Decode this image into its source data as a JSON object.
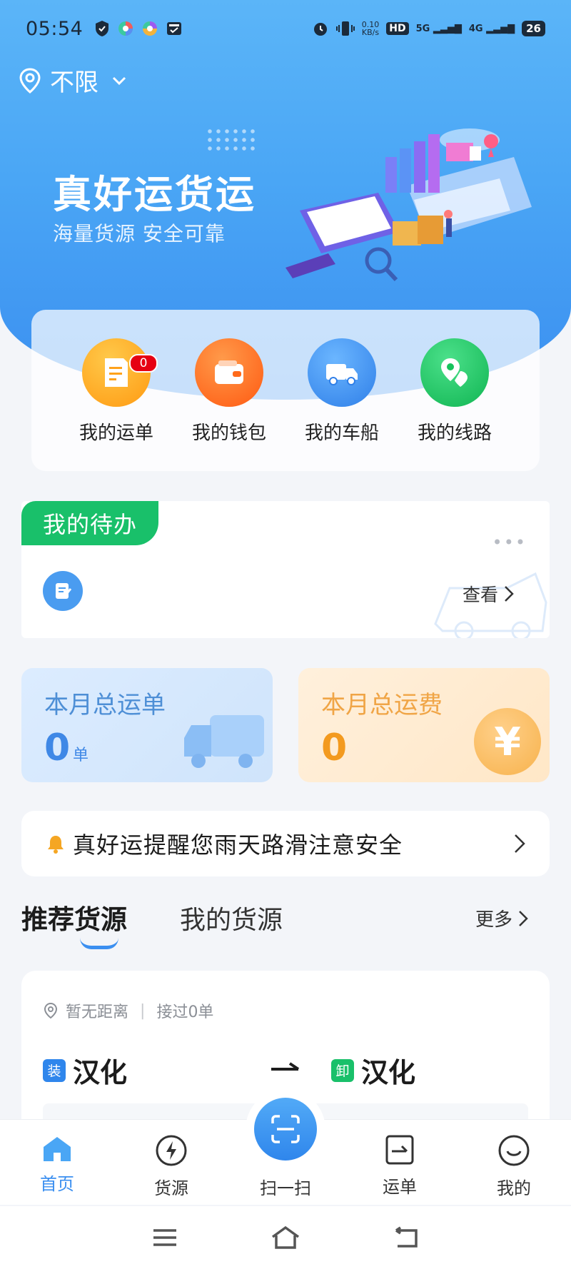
{
  "status_bar": {
    "time": "05:54",
    "net_speed_value": "0.10",
    "net_speed_unit": "KB/s",
    "hd_label": "HD",
    "signal_1": "5G",
    "signal_2": "4G",
    "battery": "26"
  },
  "location": {
    "label": "不限"
  },
  "banner": {
    "title": "真好运货运",
    "subtitle": "海量货源 安全可靠"
  },
  "quick_actions": [
    {
      "label": "我的运单",
      "icon": "waybill-icon",
      "color": "#ffa21a",
      "badge": "0"
    },
    {
      "label": "我的钱包",
      "icon": "wallet-icon",
      "color": "#ff6a1a"
    },
    {
      "label": "我的车船",
      "icon": "truck-icon",
      "color": "#3c93f3"
    },
    {
      "label": "我的线路",
      "icon": "route-icon",
      "color": "#16c35c"
    }
  ],
  "todo": {
    "tab_label": "我的待办",
    "more": "•••",
    "view_label": "查看"
  },
  "stats": {
    "monthly_orders_title": "本月总运单",
    "monthly_orders_value": "0",
    "monthly_orders_unit": "单",
    "monthly_fee_title": "本月总运费",
    "monthly_fee_value": "0",
    "yen_symbol": "¥"
  },
  "notice": {
    "text": "真好运提醒您雨天路滑注意安全"
  },
  "cargo_tabs": {
    "active": "推荐货源",
    "other": "我的货源",
    "more": "更多"
  },
  "cargo_item": {
    "distance": "暂无距离",
    "taken": "接过0单",
    "load_tag": "装",
    "load_city": "汉化",
    "unload_tag": "卸",
    "unload_city": "汉化"
  },
  "bottom_nav": {
    "home": "首页",
    "cargo": "货源",
    "scan": "扫一扫",
    "orders": "运单",
    "mine": "我的"
  },
  "colors": {
    "accent": "#3b8ff0",
    "green": "#19c06a",
    "badge_red": "#e60012"
  }
}
